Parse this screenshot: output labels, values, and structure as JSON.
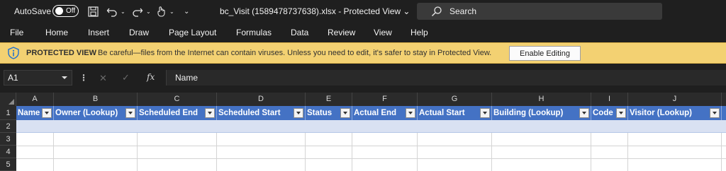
{
  "titlebar": {
    "autosave_label": "AutoSave",
    "autosave_state": "Off",
    "doc_title": "bc_Visit (1589478737638).xlsx  -  Protected View  ⌄",
    "search_placeholder": "Search"
  },
  "menu": [
    "File",
    "Home",
    "Insert",
    "Draw",
    "Page Layout",
    "Formulas",
    "Data",
    "Review",
    "View",
    "Help"
  ],
  "protected_view": {
    "title": "PROTECTED VIEW",
    "message": "Be careful—files from the Internet can contain viruses. Unless you need to edit, it's safer to stay in Protected View.",
    "button": "Enable Editing",
    "bar_color": "#f3d172"
  },
  "formula_bar": {
    "cell_ref": "A1",
    "dots": "⋮",
    "cancel": "✕",
    "enter": "✓",
    "fx": "fx",
    "value": "Name"
  },
  "grid": {
    "columns": [
      "A",
      "B",
      "C",
      "D",
      "E",
      "F",
      "G",
      "H",
      "I",
      "J"
    ],
    "rows": [
      "1",
      "2",
      "3",
      "4",
      "5"
    ],
    "headers": [
      "Name",
      "Owner (Lookup)",
      "Scheduled End",
      "Scheduled Start",
      "Status",
      "Actual End",
      "Actual Start",
      "Building (Lookup)",
      "Code",
      "Visitor (Lookup)"
    ],
    "header_color": "#4472c4",
    "band_color": "#d9e1f2"
  }
}
